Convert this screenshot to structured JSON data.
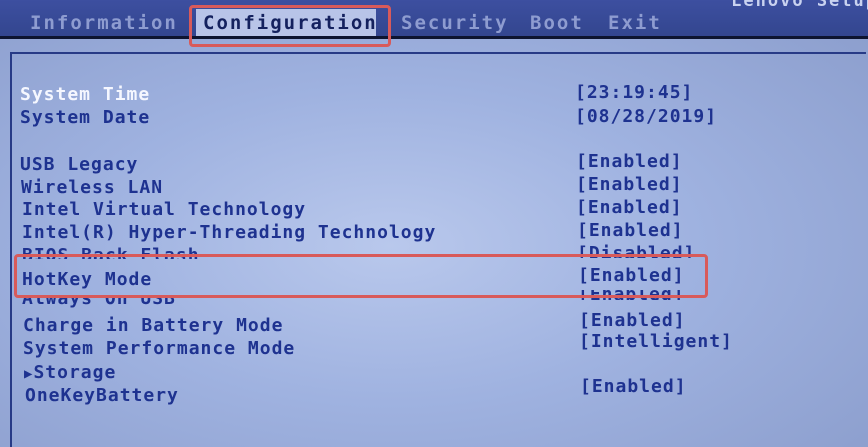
{
  "header": {
    "product_title": "Lenovo Setup",
    "menu": [
      "Information",
      "Configuration",
      "Security",
      "Boot",
      "Exit"
    ],
    "active_menu": "Configuration"
  },
  "items": [
    {
      "label": "System Time",
      "value": "[23:19:45]"
    },
    {
      "label": "System Date",
      "value": "[08/28/2019]"
    },
    {
      "label": "USB Legacy",
      "value": "[Enabled]"
    },
    {
      "label": "Wireless LAN",
      "value": "[Enabled]"
    },
    {
      "label": "Intel Virtual Technology",
      "value": "[Enabled]"
    },
    {
      "label": "Intel(R) Hyper-Threading Technology",
      "value": "[Enabled]"
    },
    {
      "label": "BIOS Back Flash",
      "value": "[Disabled]"
    },
    {
      "label": "HotKey Mode",
      "value": "[Enabled]"
    },
    {
      "label": "Always On USB",
      "value": "[Enabled]"
    },
    {
      "label": "Charge in Battery Mode",
      "value": "[Enabled]"
    },
    {
      "label": "System Performance Mode",
      "value": "[Intelligent]"
    },
    {
      "label": "Storage",
      "value": ""
    },
    {
      "label": "OneKeyBattery",
      "value": "[Enabled]"
    }
  ],
  "colors": {
    "highlight_box": "#d85a5a",
    "menu_bar": "#3d4fa0",
    "text": "#1e3290",
    "selected_text": "#f5f7ff"
  },
  "icons": {
    "submenu": "right-triangle-icon"
  }
}
